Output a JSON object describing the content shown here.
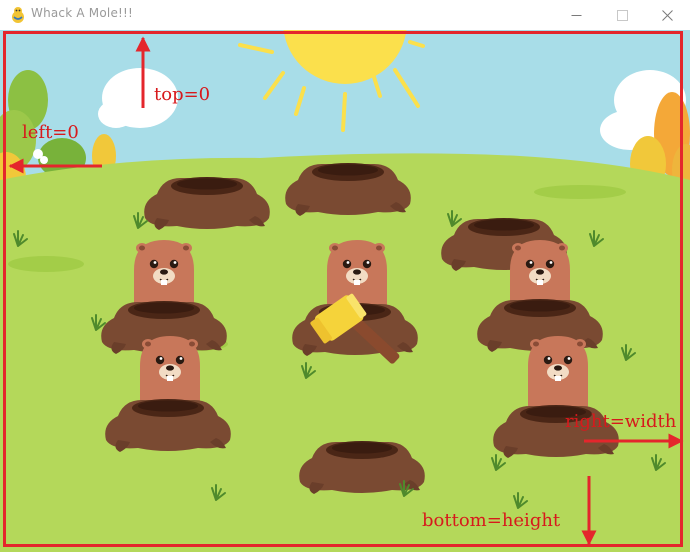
{
  "window": {
    "title": "Whack A Mole!!!",
    "app_icon": "pygame-snake-icon",
    "controls": [
      "minimize-icon",
      "maximize-icon",
      "close-icon"
    ]
  },
  "annotations": {
    "top": "top=0",
    "left": "left=0",
    "right": "right=width",
    "bottom": "bottom=height",
    "color": "#e4262c"
  },
  "game": {
    "sky_color": "#a8dde8",
    "grass_color": "#b4d85a",
    "dirt_color": "#7a4a32",
    "mole_color": "#c8775a",
    "hammer_color": "#f5d33a",
    "holes": [
      {
        "row": 1,
        "col": 1,
        "mole": false
      },
      {
        "row": 1,
        "col": 2,
        "mole": false
      },
      {
        "row": 1,
        "col": 3,
        "mole": false
      },
      {
        "row": 2,
        "col": 1,
        "mole": true
      },
      {
        "row": 2,
        "col": 2,
        "mole": true,
        "hammer": true
      },
      {
        "row": 2,
        "col": 3,
        "mole": true
      },
      {
        "row": 3,
        "col": 1,
        "mole": true
      },
      {
        "row": 3,
        "col": 2,
        "mole": false
      },
      {
        "row": 3,
        "col": 3,
        "mole": true
      }
    ]
  }
}
